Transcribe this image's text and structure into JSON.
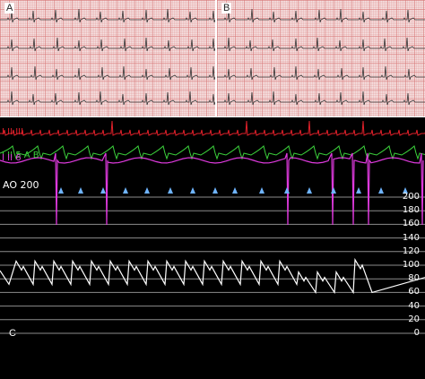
{
  "panels": {
    "a": {
      "letter": "A"
    },
    "b": {
      "letter": "B"
    },
    "c": {
      "letter": "C"
    }
  },
  "leads": [
    {
      "label": "I II III",
      "color": "#e0202a"
    },
    {
      "label": "I II 5 A B",
      "color": "#3cd23c"
    },
    {
      "label": "I II 6",
      "color": "#e03adf"
    }
  ],
  "pressure": {
    "label": "AO  200",
    "scale": [
      "200",
      "180",
      "160",
      "140",
      "120",
      "100",
      "80",
      "60",
      "40",
      "20",
      "0"
    ],
    "trace_color": "#ffffff",
    "marker_color": "#6fb4ff"
  }
}
